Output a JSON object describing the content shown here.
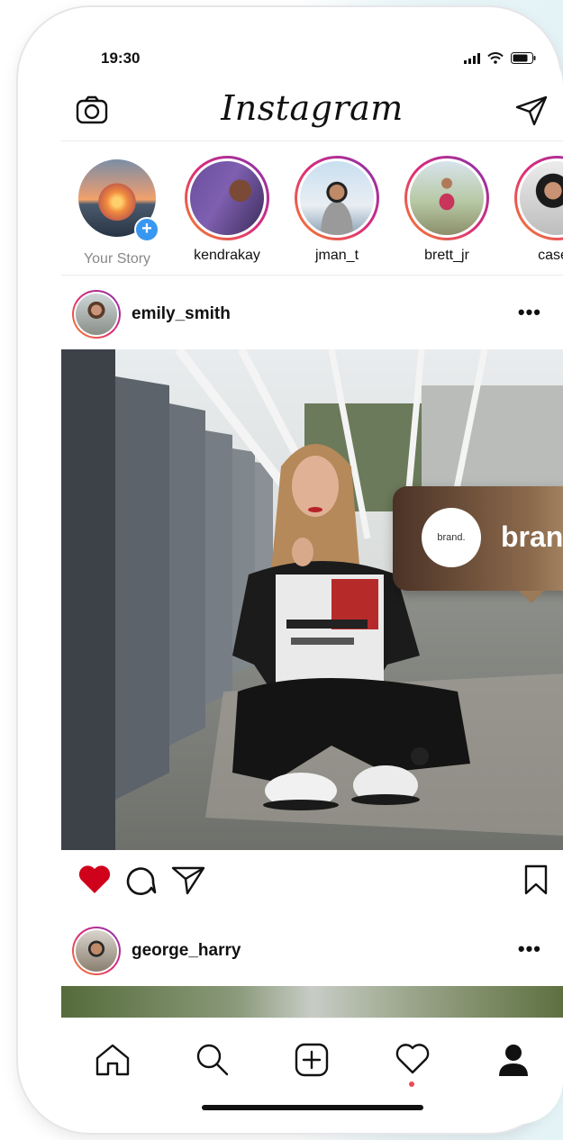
{
  "status_bar": {
    "time": "19:30"
  },
  "header": {
    "logo": "Instagram",
    "camera_icon": "camera-icon",
    "direct_icon": "paper-plane-icon"
  },
  "stories": [
    {
      "label": "Your Story",
      "own": true
    },
    {
      "label": "kendrakay"
    },
    {
      "label": "jman_t"
    },
    {
      "label": "brett_jr"
    },
    {
      "label": "casey"
    }
  ],
  "post1": {
    "username": "emily_smith",
    "more": "•••",
    "tag": {
      "logo_text": "brand.",
      "name": "brand"
    },
    "liked": true
  },
  "post2": {
    "username": "george_harry",
    "more": "•••"
  },
  "nav": [
    "home-icon",
    "search-icon",
    "add-post-icon",
    "activity-heart-icon",
    "profile-icon"
  ],
  "colors": {
    "like": "#d0021b",
    "story_gradient": [
      "#f58529",
      "#dd2a7b",
      "#8134af"
    ],
    "plus_badge": "#3897f0",
    "notif_dot": "#ed4956"
  }
}
